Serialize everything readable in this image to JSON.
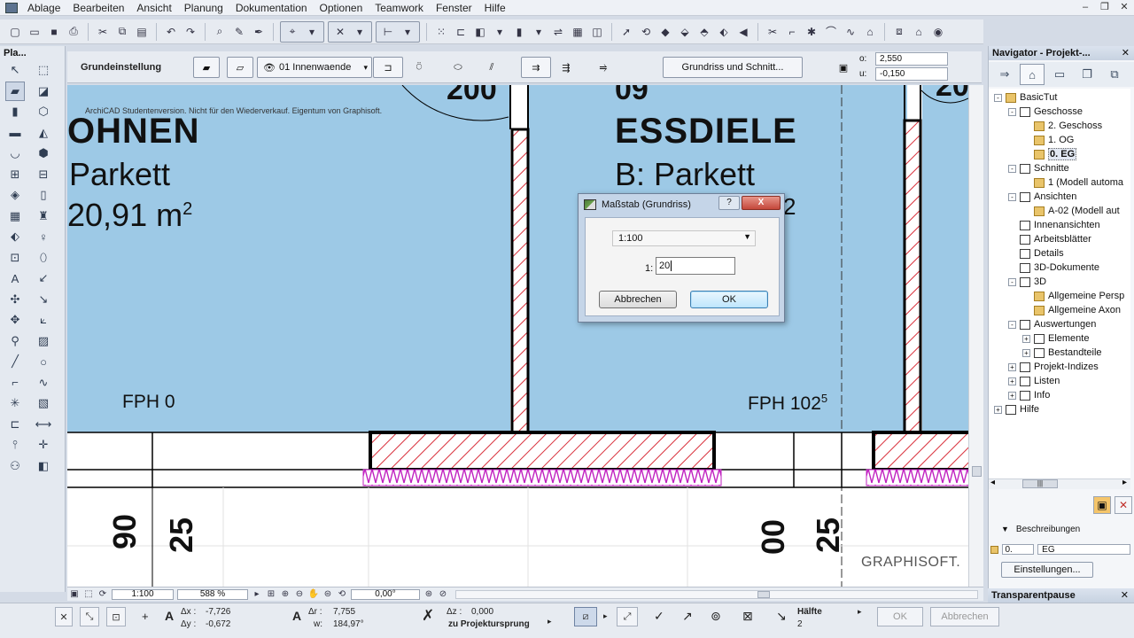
{
  "menu": {
    "items": [
      "Ablage",
      "Bearbeiten",
      "Ansicht",
      "Planung",
      "Dokumentation",
      "Optionen",
      "Teamwork",
      "Fenster",
      "Hilfe"
    ]
  },
  "toolbox": {
    "title": "Pla..."
  },
  "infobox": {
    "preset": "Grundeinstellung",
    "layer": "01 Innenwaende",
    "view_button": "Grundriss und Schnitt...",
    "top_label": "o:",
    "top_value": "2,550",
    "bottom_label": "u:",
    "bottom_value": "-0,150"
  },
  "drawing": {
    "watermark": "ArchiCAD Studentenversion. Nicht für den Wiederverkauf. Eigentum von Graphisoft.",
    "room_left_name": "OHNEN",
    "room_left_floor": "Parkett",
    "room_left_area": "20,91 m",
    "room_left_area_sup": "2",
    "room_left_top_num": "200",
    "room_right_num": "09",
    "room_right_name": "ESSDIELE",
    "room_right_floor": "B: Parkett",
    "room_right_area_tail": "2",
    "room_right_top_num": "20",
    "fph_left": "FPH 0",
    "fph_right": "FPH 102",
    "fph_right_sup": "5",
    "dim_1": "90",
    "dim_2": "25",
    "dim_3": "00",
    "dim_4": "25",
    "brand": "GRAPHISOFT."
  },
  "dialog": {
    "title": "Maßstab (Grundriss)",
    "help": "?",
    "close": "X",
    "scale_option": "1:100",
    "ratio_label": "1:",
    "ratio_value": "20",
    "cancel": "Abbrechen",
    "ok": "OK"
  },
  "status_bar": {
    "scale": "1:100",
    "zoom": "588 %",
    "angle": "0,00°"
  },
  "coords": {
    "dx_label": "Δx :",
    "dx": "-7,726",
    "dy_label": "Δy :",
    "dy": "-0,672",
    "dr_label": "Δr :",
    "dr": "7,755",
    "w_label": "w:",
    "w": "184,97°",
    "dz_label": "Δz :",
    "dz": "0,000",
    "origin": "zu Projektursprung",
    "snap_label": "Hälfte",
    "snap_value": "2",
    "ok": "OK",
    "cancel": "Abbrechen"
  },
  "navigator": {
    "title": "Navigator - Projekt-...",
    "tree": [
      {
        "label": "BasicTut",
        "level": 0,
        "exp": "-",
        "folder": true
      },
      {
        "label": "Geschosse",
        "level": 1,
        "exp": "-",
        "folder": false
      },
      {
        "label": "2. Geschoss",
        "level": 2,
        "exp": "",
        "folder": true
      },
      {
        "label": "1. OG",
        "level": 2,
        "exp": "",
        "folder": true
      },
      {
        "label": "0. EG",
        "level": 2,
        "exp": "",
        "folder": true,
        "selected": true
      },
      {
        "label": "Schnitte",
        "level": 1,
        "exp": "-",
        "folder": false
      },
      {
        "label": "1 (Modell automa",
        "level": 2,
        "exp": "",
        "folder": true
      },
      {
        "label": "Ansichten",
        "level": 1,
        "exp": "-",
        "folder": false
      },
      {
        "label": "A-02 (Modell aut",
        "level": 2,
        "exp": "",
        "folder": true
      },
      {
        "label": "Innenansichten",
        "level": 1,
        "exp": "",
        "folder": false
      },
      {
        "label": "Arbeitsblätter",
        "level": 1,
        "exp": "",
        "folder": false
      },
      {
        "label": "Details",
        "level": 1,
        "exp": "",
        "folder": false
      },
      {
        "label": "3D-Dokumente",
        "level": 1,
        "exp": "",
        "folder": false
      },
      {
        "label": "3D",
        "level": 1,
        "exp": "-",
        "folder": false
      },
      {
        "label": "Allgemeine Persp",
        "level": 2,
        "exp": "",
        "folder": true
      },
      {
        "label": "Allgemeine Axon",
        "level": 2,
        "exp": "",
        "folder": true
      },
      {
        "label": "Auswertungen",
        "level": 1,
        "exp": "-",
        "folder": false
      },
      {
        "label": "Elemente",
        "level": 2,
        "exp": "+",
        "folder": false
      },
      {
        "label": "Bestandteile",
        "level": 2,
        "exp": "+",
        "folder": false
      },
      {
        "label": "Projekt-Indizes",
        "level": 1,
        "exp": "+",
        "folder": false
      },
      {
        "label": "Listen",
        "level": 1,
        "exp": "+",
        "folder": false
      },
      {
        "label": "Info",
        "level": 1,
        "exp": "+",
        "folder": false
      },
      {
        "label": "Hilfe",
        "level": 0,
        "exp": "+",
        "folder": false
      }
    ],
    "descriptions_label": "Beschreibungen",
    "story_id": "0.",
    "story_name": "EG",
    "settings_button": "Einstellungen..."
  },
  "transparent": {
    "title": "Transparentpause"
  },
  "colors": {
    "room_fill": "#9dc9e6",
    "wall_hatch": "#d9303c",
    "insulation": "#c020c0"
  }
}
